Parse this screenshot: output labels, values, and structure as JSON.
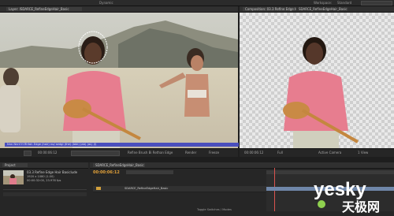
{
  "app": {
    "workspace_label": "Workspace:",
    "workspace_value": "Standard",
    "menu_label": "Dynamic"
  },
  "left_panel": {
    "tab": "Layer: ISDARCE_RefineEdgeHair_Basic",
    "status_text": "Nnn Nnnf H Rhfat: Edge (hair) no/ sedgl (the) (bbk)  (ab) (aL) (l)",
    "controls": [
      "00:00:06:12",
      "Refine Brush Bi Rethan Edge",
      "Render",
      "Freeze"
    ]
  },
  "right_panel": {
    "tab": "Composition: 03.3 Refine Edge Hair Basic",
    "tab2": "SDARCE_RefineEdgeHair_Basic",
    "controls": [
      "00:00:06:12",
      "Full",
      "Active Camera",
      "1 View"
    ]
  },
  "project_panel": {
    "tab": "Project",
    "item_name": "03.3 Refine Edge Hair Basiclude",
    "item_meta": "1920 x 1080 (1.00)",
    "item_meta2": "00:00:32:00, 23.976 fps"
  },
  "timeline": {
    "tab": "SDARCE_RefineEdgeHair_Basic",
    "timecode": "00:00:06:12",
    "layer_name": "SDARCE_RefineEdgeHair_Basic",
    "footer": "Toggle Switches / Modes"
  },
  "watermark": {
    "brand": "yesky",
    "sub": "天极网"
  },
  "colors": {
    "status_bar": "#4a4fbd",
    "accent_orange": "#e3a23a",
    "brand_green": "#8fd14f"
  }
}
